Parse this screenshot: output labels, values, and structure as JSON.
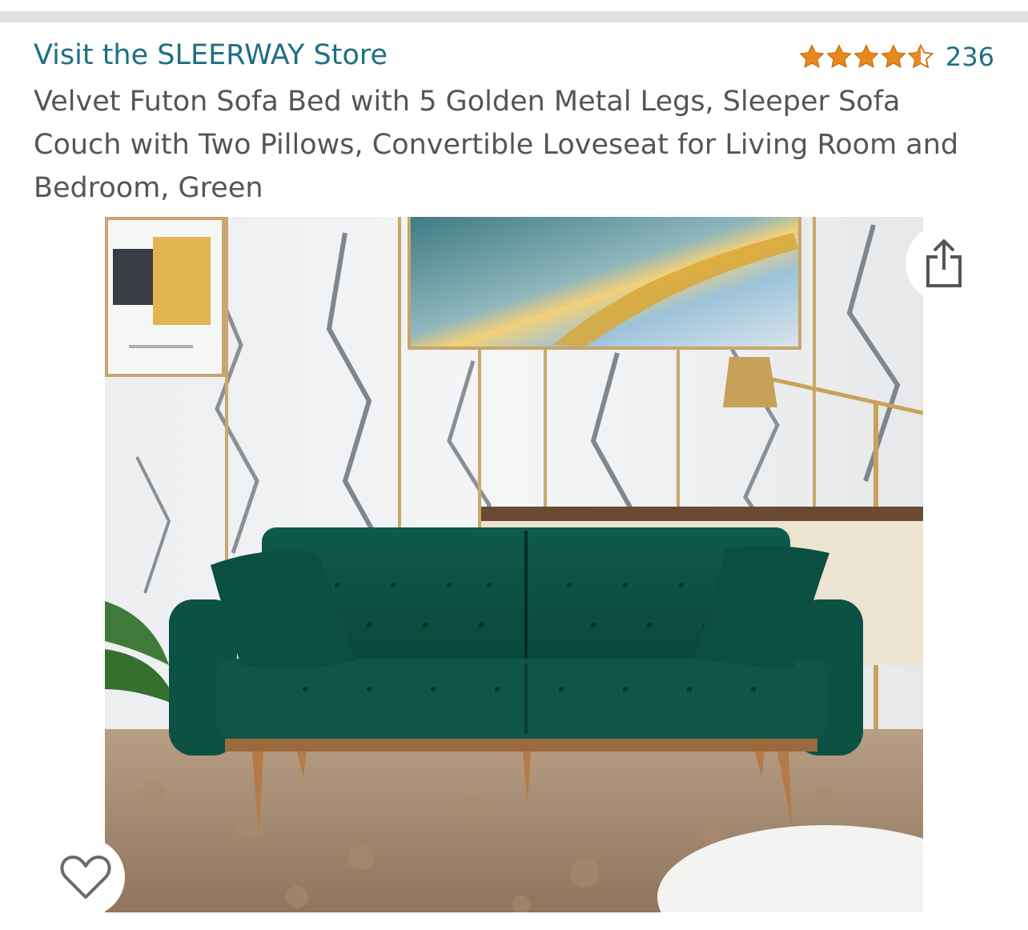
{
  "store": {
    "link_text": "Visit the SLEERWAY Store",
    "link_color": "#1f6f84"
  },
  "rating": {
    "stars": 4.5,
    "count": "236",
    "star_color": "#e8891d"
  },
  "product": {
    "title": "Velvet Futon Sofa Bed with 5 Golden Metal Legs, Sleeper Sofa Couch with Two Pillows, Convertible Loveseat for Living Room and Bedroom, Green",
    "image_icon": "product-photo-green-velvet-sofa"
  },
  "actions": {
    "share_icon": "share-icon",
    "wishlist_icon": "heart-icon"
  }
}
